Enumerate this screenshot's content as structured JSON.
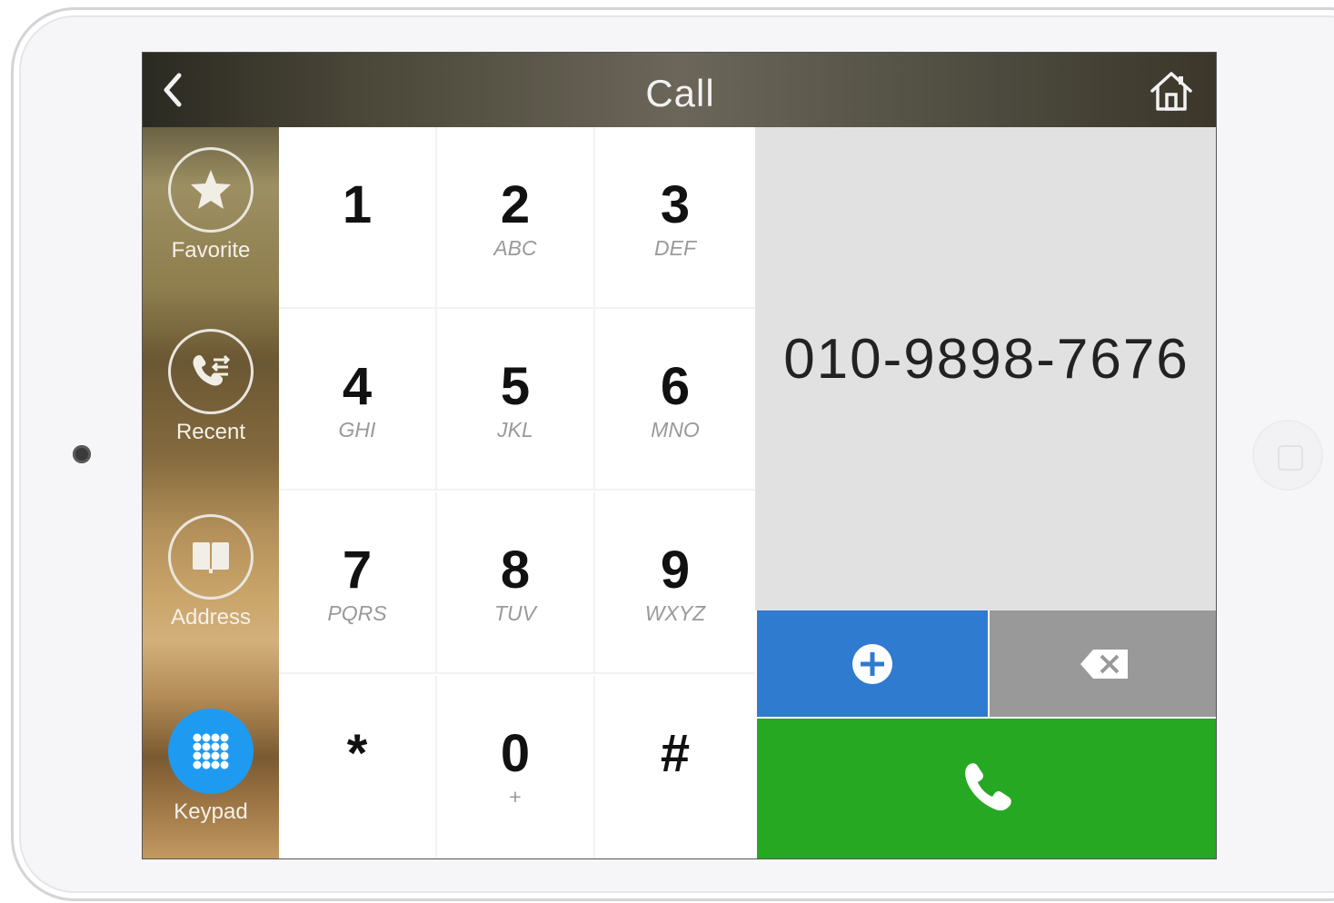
{
  "header": {
    "title": "Call",
    "back_icon": "chevron-left-icon",
    "home_icon": "home-icon"
  },
  "sidebar": {
    "items": [
      {
        "label": "Favorite",
        "icon": "star-icon",
        "active": false
      },
      {
        "label": "Recent",
        "icon": "phone-transfer-icon",
        "active": false
      },
      {
        "label": "Address",
        "icon": "book-icon",
        "active": false
      },
      {
        "label": "Keypad",
        "icon": "keypad-grid-icon",
        "active": true
      }
    ]
  },
  "keypad": {
    "keys": [
      {
        "digit": "1",
        "letters": ""
      },
      {
        "digit": "2",
        "letters": "ABC"
      },
      {
        "digit": "3",
        "letters": "DEF"
      },
      {
        "digit": "4",
        "letters": "GHI"
      },
      {
        "digit": "5",
        "letters": "JKL"
      },
      {
        "digit": "6",
        "letters": "MNO"
      },
      {
        "digit": "7",
        "letters": "PQRS"
      },
      {
        "digit": "8",
        "letters": "TUV"
      },
      {
        "digit": "9",
        "letters": "WXYZ"
      },
      {
        "digit": "*",
        "letters": ""
      },
      {
        "digit": "0",
        "letters": "+"
      },
      {
        "digit": "#",
        "letters": ""
      }
    ]
  },
  "display": {
    "number": "010-9898-7676"
  },
  "actions": {
    "add_icon": "plus-circle-icon",
    "delete_icon": "backspace-icon",
    "call_icon": "phone-icon"
  },
  "colors": {
    "active_blue": "#1e9bf0",
    "add_blue": "#2f7bd0",
    "delete_gray": "#999999",
    "call_green": "#27a822",
    "display_bg": "#e1e1e1"
  }
}
